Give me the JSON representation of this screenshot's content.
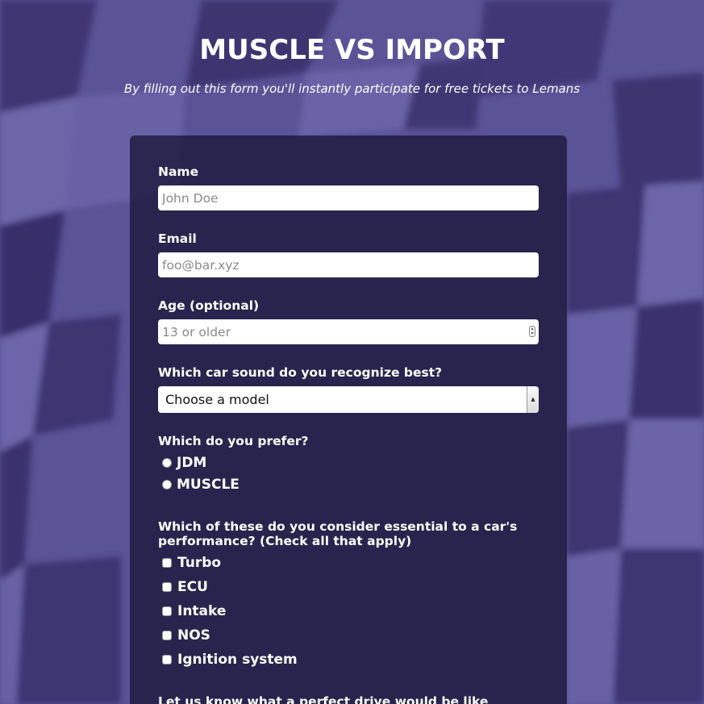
{
  "header": {
    "title": "MUSCLE VS IMPORT",
    "subtitle": "By filling out this form you'll instantly participate for free tickets to Lemans"
  },
  "form": {
    "name": {
      "label": "Name",
      "placeholder": "John Doe",
      "value": ""
    },
    "email": {
      "label": "Email",
      "placeholder": "foo@bar.xyz",
      "value": ""
    },
    "age": {
      "label": "Age (optional)",
      "placeholder": "13 or older",
      "value": ""
    },
    "car_sound": {
      "label": "Which car sound do you recognize best?",
      "selected": "Choose a model"
    },
    "preference": {
      "label": "Which do you prefer?",
      "options": [
        {
          "label": "JDM",
          "checked": false
        },
        {
          "label": "MUSCLE",
          "checked": false
        }
      ]
    },
    "essentials": {
      "label_line1": "Which of these do you consider essential to a car's",
      "label_line2": "performance? (Check all that apply)",
      "options": [
        {
          "label": "Turbo",
          "checked": false
        },
        {
          "label": "ECU",
          "checked": false
        },
        {
          "label": "Intake",
          "checked": false
        },
        {
          "label": "NOS",
          "checked": false
        },
        {
          "label": "Ignition system",
          "checked": false
        }
      ]
    },
    "perfect_drive": {
      "label": "Let us know what a perfect drive would be like"
    }
  },
  "colors": {
    "background": "#4e4788",
    "panel": "#1b1738",
    "text": "#ffffff"
  },
  "icons": {
    "select_arrow": "chevron-down-icon",
    "number_spin": "spinner-icon"
  }
}
